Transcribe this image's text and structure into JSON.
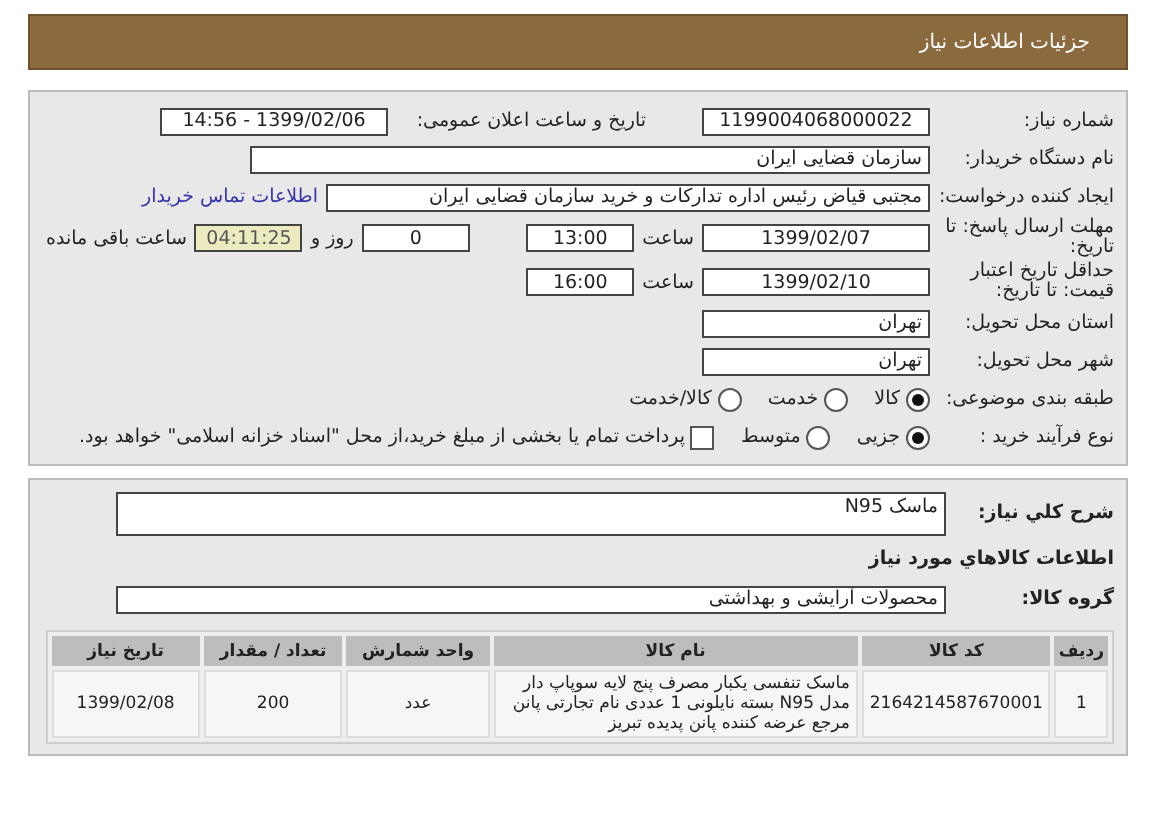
{
  "header": {
    "title": "جزئیات اطلاعات نیاز"
  },
  "need_number": {
    "label": "شماره نیاز:",
    "value": "1199004068000022"
  },
  "announce": {
    "label": "تاریخ و ساعت اعلان عمومی:",
    "value": "1399/02/06 - 14:56"
  },
  "buyer": {
    "label": "نام دستگاه خریدار:",
    "value": "سازمان قضایی ایران"
  },
  "creator": {
    "label": "ایجاد کننده درخواست:",
    "value": "مجتبی  قیاض رئیس اداره تدارکات و خرید سازمان قضایی ایران",
    "link": "اطلاعات تماس خریدار"
  },
  "deadline": {
    "label": "مهلت ارسال پاسخ: تا تاریخ:",
    "date": "1399/02/07",
    "time_label": "ساعت",
    "time": "13:00",
    "days": "0",
    "days_label": "روز و",
    "remaining": "04:11:25",
    "remaining_label": "ساعت باقی مانده"
  },
  "validity": {
    "label": "حداقل تاریخ اعتبار قیمت: تا تاریخ:",
    "date": "1399/02/10",
    "time_label": "ساعت",
    "time": "16:00"
  },
  "province": {
    "label": "استان محل تحویل:",
    "value": "تهران"
  },
  "city": {
    "label": "شهر محل تحویل:",
    "value": "تهران"
  },
  "category": {
    "label": "طبقه بندی موضوعی:",
    "options": [
      {
        "label": "کالا",
        "selected": true
      },
      {
        "label": "خدمت",
        "selected": false
      },
      {
        "label": "کالا/خدمت",
        "selected": false
      }
    ]
  },
  "process": {
    "label": "نوع فرآیند خرید :",
    "options": [
      {
        "label": "جزیی",
        "selected": true
      },
      {
        "label": "متوسط",
        "selected": false
      }
    ],
    "treasury": {
      "label": "پرداخت تمام یا بخشی از مبلغ خرید،از محل \"اسناد خزانه اسلامی\" خواهد بود.",
      "checked": false
    }
  },
  "description": {
    "label": "شرح کلي نياز:",
    "value": "ماسک  N95"
  },
  "goods_title": "اطلاعات کالاهاي مورد نياز",
  "goods_group": {
    "label": "گروه کالا:",
    "value": "محصولات آرایشی و بهداشتی"
  },
  "table": {
    "columns": [
      "ردیف",
      "کد کالا",
      "نام کالا",
      "واحد شمارش",
      "تعداد / مقدار",
      "تاریخ نیاز"
    ],
    "rows": [
      [
        "1",
        "2164214587670001",
        "ماسک تنفسی یکبار مصرف پنج لایه سوپاپ دار مدل N95 بسته نایلونی 1 عددی نام تجارتی پانن مرجع عرضه کننده پانن پدیده تبریز",
        "عدد",
        "200",
        "1399/02/08"
      ]
    ]
  }
}
